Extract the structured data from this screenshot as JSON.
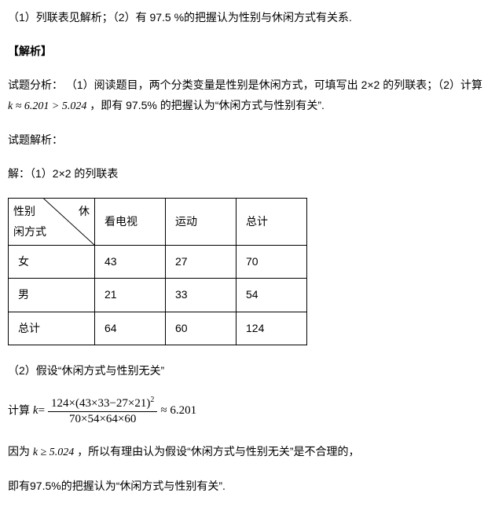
{
  "summary_line": "（1）列联表见解析；（2）有 97.5 %的把握认为性别与休闲方式有关系.",
  "analysis_header": "【解析】",
  "analysis_label": "试题分析：",
  "analysis_part1": "（1）阅读题目，两个分类变量是性别是休闲方式，可填写出 2×2 的列联表；（2）计算",
  "analysis_expr1": "k ≈ 6.201 > 5.024",
  "analysis_part2": "，即有 97.5% 的把握认为“休闲方式与性别有关”.",
  "solution_label": "试题解析：",
  "sol_line": "解：（1）2×2 的列联表",
  "table": {
    "header_left_top": "性别",
    "header_left_right": "休",
    "header_left_bottom": "闲方式",
    "col1": "看电视",
    "col2": "运动",
    "col3": "总计",
    "rows": [
      {
        "label": "女",
        "c1": "43",
        "c2": "27",
        "c3": "70"
      },
      {
        "label": "男",
        "c1": "21",
        "c2": "33",
        "c3": "54"
      },
      {
        "label": "总计",
        "c1": "64",
        "c2": "60",
        "c3": "124"
      }
    ]
  },
  "part2_hypothesis": "（2）假设“休闲方式与性别无关”",
  "calc_prefix": "计算",
  "calc_k": "k",
  "calc_eq": " = ",
  "calc_num": "124×(43×33−27×21)",
  "calc_exp": "2",
  "calc_den": "70×54×64×60",
  "calc_approx": " ≈ 6.201",
  "because_pre": "因为",
  "because_expr": "k ≥ 5.024",
  "because_post": " ，所以有理由认为假设“休闲方式与性别无关”是不合理的，",
  "conclusion": "即有97.5%的把握认为“休闲方式与性别有关”."
}
